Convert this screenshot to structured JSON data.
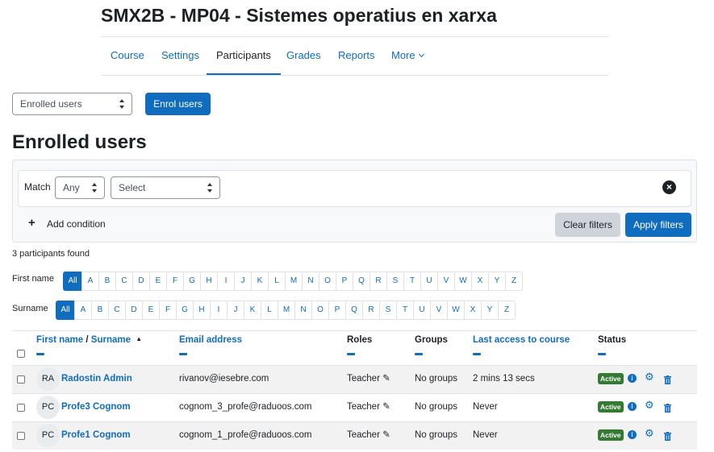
{
  "course": {
    "title": "SMX2B - MP04 - Sistemes operatius en xarxa"
  },
  "nav": {
    "tabs": [
      {
        "label": "Course"
      },
      {
        "label": "Settings"
      },
      {
        "label": "Participants",
        "active": true
      },
      {
        "label": "Grades"
      },
      {
        "label": "Reports"
      },
      {
        "label": "More"
      }
    ]
  },
  "toolbar": {
    "view_select": "Enrolled users",
    "enrol_button": "Enrol users"
  },
  "heading": "Enrolled users",
  "filters": {
    "match_label": "Match",
    "match_value": "Any",
    "type_select": "Select",
    "add_condition": "Add condition",
    "clear_button": "Clear filters",
    "apply_button": "Apply filters",
    "remove_icon": "close-circle-icon"
  },
  "found_text": "3 participants found",
  "firstname_filter": {
    "label": "First name",
    "letters": [
      "All",
      "A",
      "B",
      "C",
      "D",
      "E",
      "F",
      "G",
      "H",
      "I",
      "J",
      "K",
      "L",
      "M",
      "N",
      "O",
      "P",
      "Q",
      "R",
      "S",
      "T",
      "U",
      "V",
      "W",
      "X",
      "Y",
      "Z"
    ],
    "active": "All"
  },
  "surname_filter": {
    "label": "Surname",
    "letters": [
      "All",
      "A",
      "B",
      "C",
      "D",
      "E",
      "F",
      "G",
      "H",
      "I",
      "J",
      "K",
      "L",
      "M",
      "N",
      "O",
      "P",
      "Q",
      "R",
      "S",
      "T",
      "U",
      "V",
      "W",
      "X",
      "Y",
      "Z"
    ],
    "active": "All"
  },
  "table": {
    "headers": {
      "first_name": "First name",
      "separator": "/",
      "surname": "Surname",
      "email": "Email address",
      "roles": "Roles",
      "groups": "Groups",
      "last_access": "Last access to course",
      "status": "Status"
    },
    "rows": [
      {
        "initials": "RA",
        "name": "Radostin Admin",
        "email": "rivanov@iesebre.com",
        "role": "Teacher",
        "groups": "No groups",
        "last_access": "2 mins 13 secs",
        "status": "Active"
      },
      {
        "initials": "PC",
        "name": "Profe3 Cognom",
        "email": "cognom_3_profe@raduoos.com",
        "role": "Teacher",
        "groups": "No groups",
        "last_access": "Never",
        "status": "Active"
      },
      {
        "initials": "PC",
        "name": "Profe1 Cognom",
        "email": "cognom_1_profe@raduoos.com",
        "role": "Teacher",
        "groups": "No groups",
        "last_access": "Never",
        "status": "Active"
      }
    ]
  },
  "colors": {
    "link": "#0f6cbf",
    "active_badge": "#357a32",
    "primary_button": "#0f6cbf"
  }
}
